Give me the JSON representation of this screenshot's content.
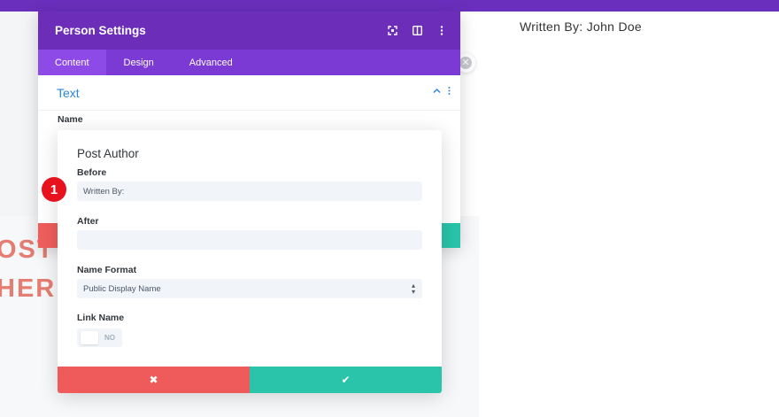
{
  "background": {
    "author_line": "Written By: John Doe",
    "big_line_1": "OST",
    "big_line_2": "HER"
  },
  "panel": {
    "title": "Person Settings",
    "header_icons": [
      "focus-icon",
      "columns-icon",
      "more-vertical-icon"
    ],
    "tabs": [
      {
        "label": "Content",
        "active": true
      },
      {
        "label": "Design",
        "active": false
      },
      {
        "label": "Advanced",
        "active": false
      }
    ],
    "section_title": "Text",
    "field_label": "Name"
  },
  "popup": {
    "title": "Post Author",
    "before_label": "Before",
    "before_value": "Written By:",
    "after_label": "After",
    "after_value": "",
    "name_format_label": "Name Format",
    "name_format_value": "Public Display Name",
    "link_name_label": "Link Name",
    "link_name_toggle": "NO",
    "cancel_icon": "✖",
    "confirm_icon": "✔"
  },
  "badge": {
    "number": "1",
    "color": "#e8121f"
  },
  "colors": {
    "header_purple": "#6c2eb9",
    "tab_purple": "#7b3ad4",
    "accent_blue": "#2b87da",
    "cancel_red": "#ef5b5b",
    "confirm_green": "#29c4a9"
  }
}
